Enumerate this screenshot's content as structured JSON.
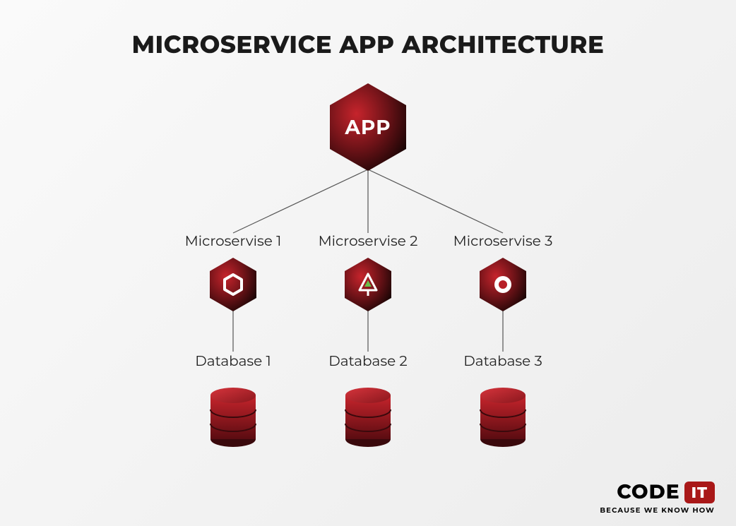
{
  "title": "MICROSERVICE APP ARCHITECTURE",
  "app_label": "APP",
  "microservices": [
    {
      "label": "Microservise 1",
      "db_label": "Database 1",
      "icon": "hex-outline-icon"
    },
    {
      "label": "Microservise 2",
      "db_label": "Database 2",
      "icon": "tree-outline-icon"
    },
    {
      "label": "Microservise 3",
      "db_label": "Database 3",
      "icon": "ring-icon"
    }
  ],
  "footer": {
    "brand_main": "CODE",
    "brand_accent": "IT",
    "tagline": "BECAUSE WE KNOW HOW"
  },
  "colors": {
    "hex_dark": "#1a0505",
    "hex_light": "#b71f27",
    "db_dark": "#5a0c11",
    "db_light": "#c6242c",
    "line": "#555"
  }
}
